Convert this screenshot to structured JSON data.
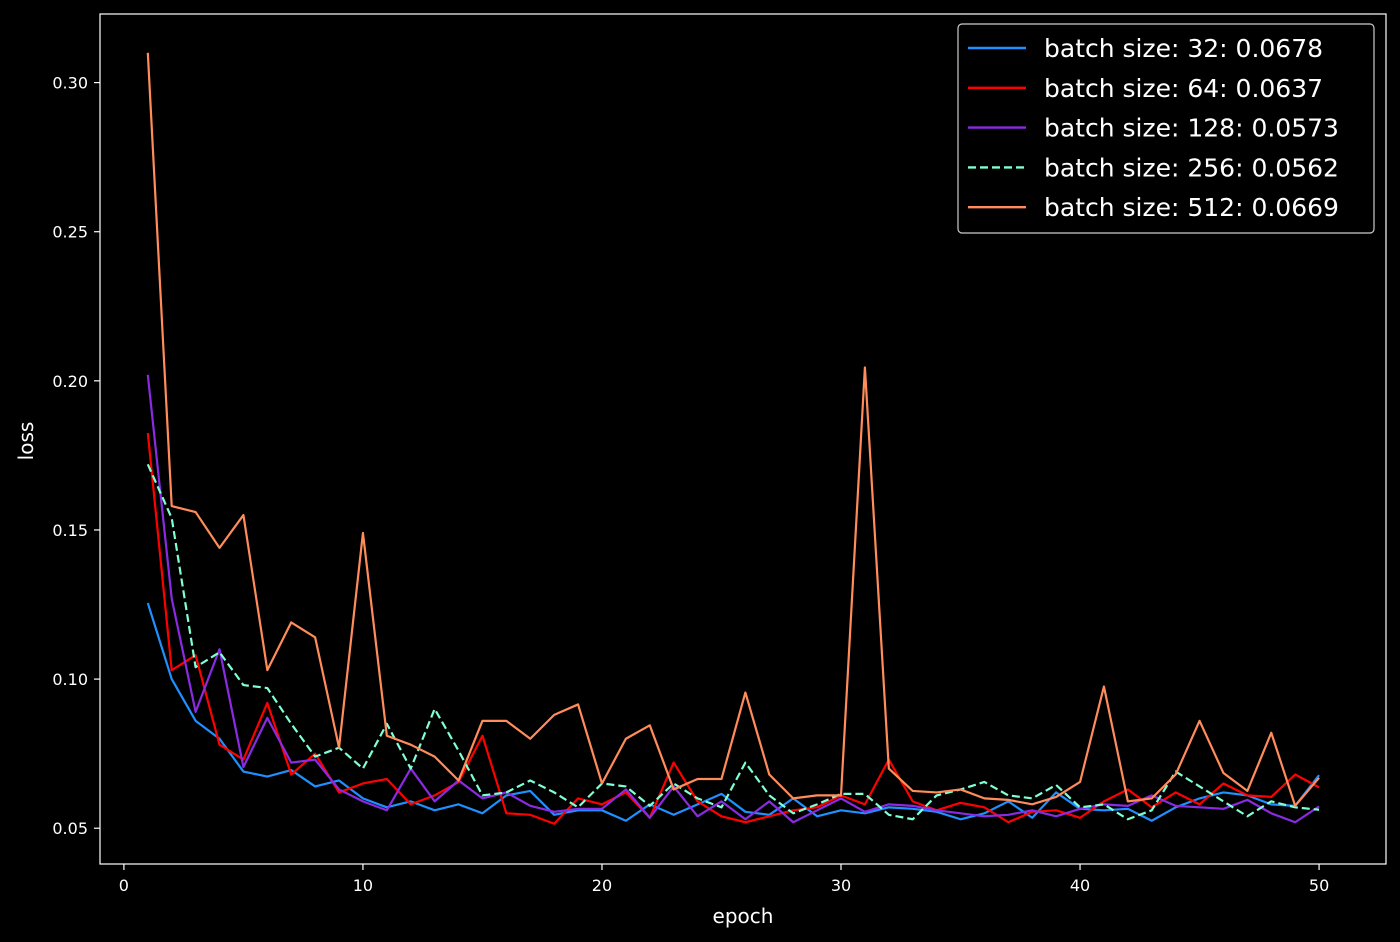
{
  "chart_data": {
    "type": "line",
    "title": "",
    "xlabel": "epoch",
    "ylabel": "loss",
    "xlim": [
      -1,
      52.8
    ],
    "ylim": [
      0.038,
      0.323
    ],
    "xticks": [
      0,
      10,
      20,
      30,
      40,
      50
    ],
    "yticks": [
      0.05,
      0.1,
      0.15,
      0.2,
      0.25,
      0.3
    ],
    "ytick_labels": [
      "0.05",
      "0.10",
      "0.15",
      "0.20",
      "0.25",
      "0.30"
    ],
    "grid": false,
    "legend_position": "top-right",
    "background": "#000000",
    "x": [
      1,
      2,
      3,
      4,
      5,
      6,
      7,
      8,
      9,
      10,
      11,
      12,
      13,
      14,
      15,
      16,
      17,
      18,
      19,
      20,
      21,
      22,
      23,
      24,
      25,
      26,
      27,
      28,
      29,
      30,
      31,
      32,
      33,
      34,
      35,
      36,
      37,
      38,
      39,
      40,
      41,
      42,
      43,
      44,
      45,
      46,
      47,
      48,
      49,
      50
    ],
    "series": [
      {
        "name": "batch size: 32: 0.0678",
        "color": "#1e90ff",
        "dash": "solid",
        "values": [
          0.1255,
          0.1,
          0.086,
          0.08,
          0.069,
          0.0673,
          0.0695,
          0.064,
          0.066,
          0.06,
          0.057,
          0.059,
          0.056,
          0.058,
          0.055,
          0.061,
          0.0625,
          0.0545,
          0.056,
          0.056,
          0.0525,
          0.058,
          0.0545,
          0.058,
          0.0615,
          0.0555,
          0.0545,
          0.06,
          0.054,
          0.056,
          0.055,
          0.057,
          0.0565,
          0.0555,
          0.053,
          0.055,
          0.059,
          0.0535,
          0.062,
          0.0565,
          0.056,
          0.0565,
          0.0525,
          0.057,
          0.06,
          0.062,
          0.061,
          0.058,
          0.0575,
          0.0678
        ]
      },
      {
        "name": "batch size: 64: 0.0637",
        "color": "#ff0000",
        "dash": "solid",
        "values": [
          0.1825,
          0.103,
          0.108,
          0.078,
          0.073,
          0.092,
          0.068,
          0.075,
          0.062,
          0.065,
          0.0665,
          0.058,
          0.061,
          0.0655,
          0.081,
          0.055,
          0.0545,
          0.0515,
          0.06,
          0.058,
          0.062,
          0.0535,
          0.072,
          0.059,
          0.054,
          0.052,
          0.054,
          0.056,
          0.057,
          0.061,
          0.058,
          0.073,
          0.059,
          0.056,
          0.0585,
          0.057,
          0.052,
          0.0555,
          0.056,
          0.0535,
          0.059,
          0.063,
          0.057,
          0.062,
          0.058,
          0.065,
          0.061,
          0.0605,
          0.068,
          0.0637
        ]
      },
      {
        "name": "batch size: 128: 0.0573",
        "color": "#8a2be2",
        "dash": "solid",
        "values": [
          0.202,
          0.127,
          0.089,
          0.11,
          0.0705,
          0.087,
          0.072,
          0.073,
          0.063,
          0.059,
          0.056,
          0.07,
          0.059,
          0.066,
          0.06,
          0.062,
          0.0575,
          0.0555,
          0.0565,
          0.0565,
          0.063,
          0.0535,
          0.064,
          0.054,
          0.059,
          0.053,
          0.059,
          0.052,
          0.056,
          0.06,
          0.0555,
          0.058,
          0.0575,
          0.056,
          0.055,
          0.054,
          0.0545,
          0.056,
          0.054,
          0.0565,
          0.058,
          0.0575,
          0.061,
          0.0575,
          0.057,
          0.0565,
          0.0595,
          0.055,
          0.052,
          0.0573
        ]
      },
      {
        "name": "batch size: 256: 0.0562",
        "color": "#7fffd4",
        "dash": "dashed",
        "values": [
          0.172,
          0.154,
          0.104,
          0.109,
          0.098,
          0.097,
          0.085,
          0.074,
          0.077,
          0.07,
          0.085,
          0.07,
          0.09,
          0.076,
          0.061,
          0.062,
          0.066,
          0.062,
          0.057,
          0.065,
          0.064,
          0.0575,
          0.065,
          0.06,
          0.057,
          0.072,
          0.061,
          0.055,
          0.058,
          0.0615,
          0.0615,
          0.0545,
          0.053,
          0.061,
          0.063,
          0.0655,
          0.061,
          0.06,
          0.0645,
          0.057,
          0.058,
          0.053,
          0.056,
          0.069,
          0.064,
          0.059,
          0.054,
          0.059,
          0.057,
          0.0562
        ]
      },
      {
        "name": "batch size: 512: 0.0669",
        "color": "#ff8c5a",
        "dash": "solid",
        "values": [
          0.31,
          0.158,
          0.156,
          0.144,
          0.155,
          0.103,
          0.119,
          0.114,
          0.077,
          0.149,
          0.081,
          0.078,
          0.074,
          0.066,
          0.086,
          0.086,
          0.08,
          0.088,
          0.0915,
          0.065,
          0.08,
          0.0845,
          0.063,
          0.0665,
          0.0665,
          0.0955,
          0.068,
          0.06,
          0.061,
          0.061,
          0.2045,
          0.07,
          0.0625,
          0.062,
          0.063,
          0.06,
          0.0595,
          0.058,
          0.0605,
          0.0655,
          0.0975,
          0.059,
          0.06,
          0.068,
          0.086,
          0.0685,
          0.0625,
          0.082,
          0.0575,
          0.0669
        ]
      }
    ]
  }
}
